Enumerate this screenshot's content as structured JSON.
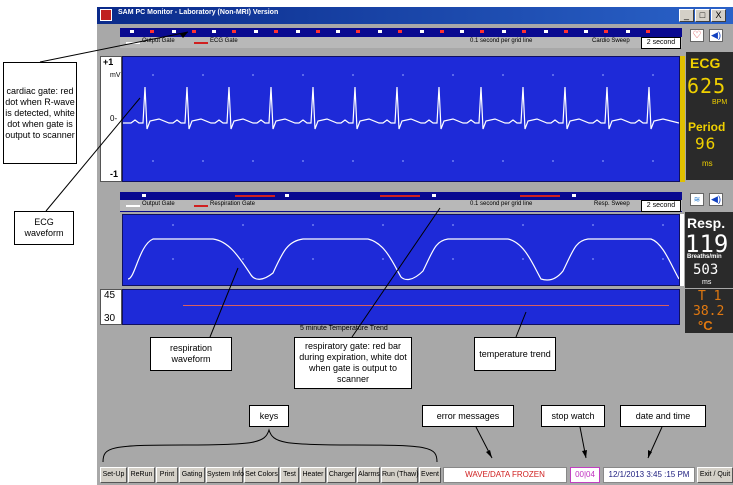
{
  "window": {
    "title": "SAM PC Monitor - Laboratory (Non-MRI) Version",
    "min": "_",
    "max": "□",
    "close": "X"
  },
  "ecg_strip": {
    "gate1": "Output Gate",
    "gate2": "ECG Gate",
    "grid": "0.1 second per grid line",
    "sweep_label": "Cardio Sweep",
    "sweep_value": "2 second"
  },
  "ecg_panel": {
    "top": "+1",
    "unit": "mV",
    "zero": "0-",
    "bottom": "-1"
  },
  "ecg_readout": {
    "label": "ECG",
    "bpm": "625",
    "bpm_unit": "BPM",
    "period_label": "Period",
    "period": "96",
    "period_unit": "ms"
  },
  "resp_strip": {
    "gate1": "Output Gate",
    "gate2": "Respiration Gate",
    "grid": "0.1 second per grid line",
    "sweep_label": "Resp. Sweep",
    "sweep_value": "2 second"
  },
  "resp_readout": {
    "label": "Resp.",
    "rate": "119",
    "rate_unit": "Breaths/min",
    "period": "503",
    "period_unit": "ms"
  },
  "temp_panel": {
    "top": "45",
    "bottom": "30",
    "caption": "5 minute Temperature Trend"
  },
  "temp_readout": {
    "label": "T 1",
    "value": "38.2",
    "unit": "°C"
  },
  "annotations": {
    "cardiac_gate": "cardiac gate: red dot when R-wave is detected, white dot when gate is output to scanner",
    "ecg_waveform": "ECG waveform",
    "resp_waveform": "respiration waveform",
    "resp_gate": "respiratory gate: red bar during expiration, white dot when gate is output to scanner",
    "temp_trend": "temperature trend",
    "keys": "keys",
    "errors": "error messages",
    "stopwatch": "stop watch",
    "datetime": "date and time"
  },
  "toolbar": {
    "buttons": [
      "Set-Up",
      "ReRun",
      "Print",
      "Gating",
      "System Info",
      "Set Colors",
      "Test",
      "Heater",
      "Charger",
      "Alarms",
      "Run (Thaw)",
      "Event"
    ],
    "error": "WAVE/DATA FROZEN",
    "stopwatch": "00|04",
    "datetime": "12/1/2013  3:45 :15 PM",
    "exit": "Exit / Quit"
  },
  "colors": {
    "panel": "#1e2ad8",
    "trace": "#ffffff",
    "readout_yellow": "#f0d000",
    "temp_orange": "#e07810",
    "error_red": "#d02020"
  }
}
